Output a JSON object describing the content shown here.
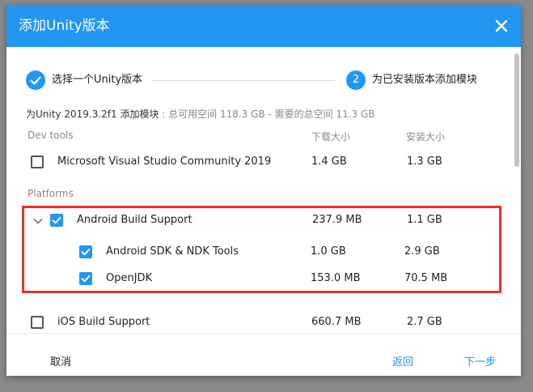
{
  "dialog": {
    "title": "添加Unity版本",
    "close_icon": "close-icon"
  },
  "stepper": {
    "step1": {
      "label": "选择一个Unity版本",
      "state": "done"
    },
    "step2": {
      "number": "2",
      "label": "为已安装版本添加模块",
      "state": "active"
    }
  },
  "info": {
    "main": "为Unity 2019.3.2f1 添加模块",
    "muted": " : 总可用空间 118.3 GB - 需要的总空间 11.3 GB"
  },
  "columns": {
    "download": "下载大小",
    "install": "安装大小"
  },
  "sections": {
    "dev_tools": "Dev tools",
    "platforms": "Platforms"
  },
  "modules": {
    "vs": {
      "label": "Microsoft Visual Studio Community 2019",
      "download": "1.4 GB",
      "install": "1.3 GB",
      "checked": false
    },
    "android": {
      "label": "Android Build Support",
      "download": "237.9 MB",
      "install": "1.1 GB",
      "checked": true,
      "expanded": true
    },
    "android_sdk": {
      "label": "Android SDK & NDK Tools",
      "download": "1.0 GB",
      "install": "2.9 GB",
      "checked": true
    },
    "openjdk": {
      "label": "OpenJDK",
      "download": "153.0 MB",
      "install": "70.5 MB",
      "checked": true
    },
    "ios": {
      "label": "iOS Build Support",
      "download": "660.7 MB",
      "install": "2.7 GB",
      "checked": false
    }
  },
  "footer": {
    "cancel": "取消",
    "back": "返回",
    "next": "下一步"
  },
  "colors": {
    "accent": "#2196f3",
    "highlight": "#e8322f"
  }
}
